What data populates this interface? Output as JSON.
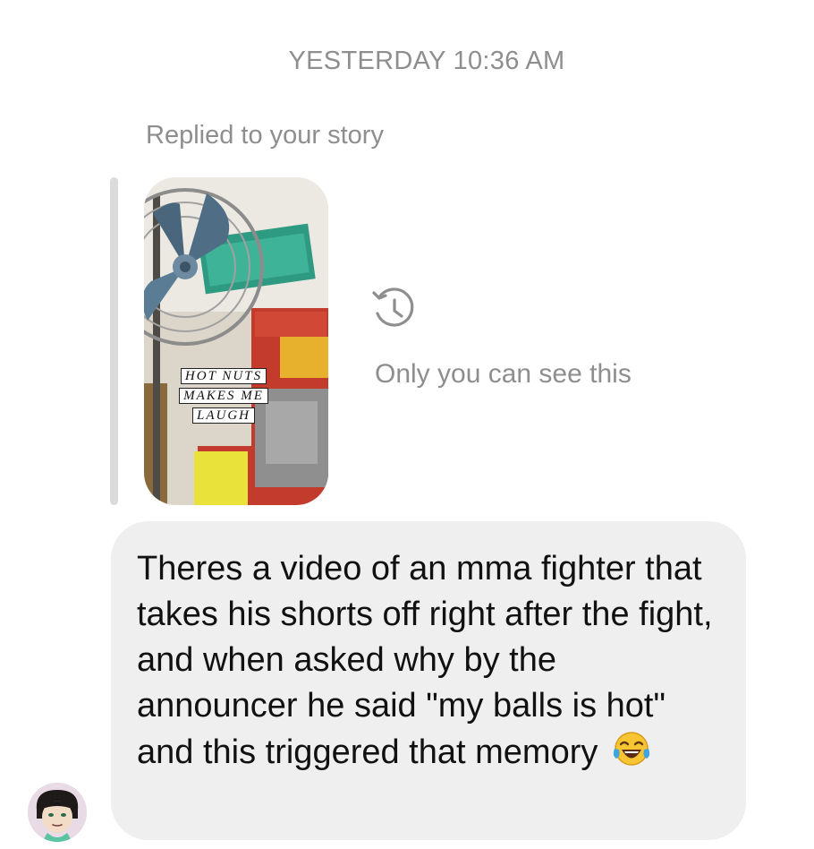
{
  "thread": {
    "timestamp": "YESTERDAY 10:36 AM",
    "reply_context": "Replied to your story",
    "story_reply": {
      "sticker_text": "HOT NUTS MAKES ME LAUGH",
      "visibility_note": "Only you can see this",
      "visibility_icon": "history-clock-icon"
    },
    "message": {
      "text": "Theres a video of an mma fighter that takes his shorts off right after the fight, and when asked why by the announcer he said \"my balls is hot\" and this triggered that memory",
      "emoji": "face-with-tears-of-joy"
    },
    "sender_avatar": "cartoon-avatar"
  }
}
